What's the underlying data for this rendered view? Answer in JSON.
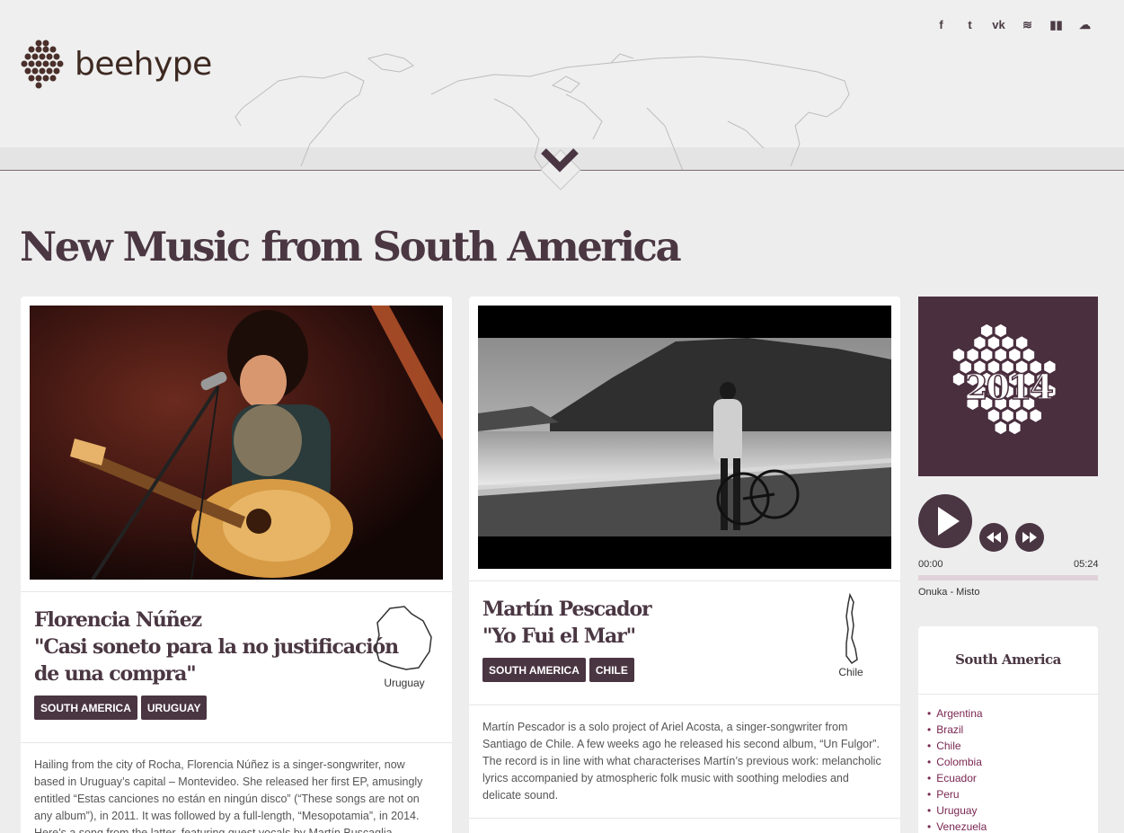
{
  "brand": {
    "name": "beehype"
  },
  "social": [
    {
      "icon": "facebook-icon",
      "glyph": "f"
    },
    {
      "icon": "twitter-icon",
      "glyph": "t"
    },
    {
      "icon": "vk-icon",
      "glyph": "vk"
    },
    {
      "icon": "spotify-icon",
      "glyph": "≋"
    },
    {
      "icon": "deezer-icon",
      "glyph": "▮▮"
    },
    {
      "icon": "soundcloud-icon",
      "glyph": "☁"
    }
  ],
  "page": {
    "title": "New Music from South America"
  },
  "posts": [
    {
      "title_line1": "Florencia Núñez",
      "title_line2": "\"Casi soneto para la no justificación",
      "title_line3": "de una compra\"",
      "tags": [
        "SOUTH AMERICA",
        "URUGUAY"
      ],
      "country": "Uruguay",
      "text": "Hailing from the city of Rocha, Florencia Núñez is a singer-songwriter, now based in Uruguay’s capital – Montevideo. She released her first EP, amusingly entitled “Estas canciones no están en ningún disco” (“These songs are not on any album”), in 2011. It was followed by a full-length, “Mesopotamia”, in 2014. Here’s a song from the latter, featuring guest vocals by Martín Buscaglia."
    },
    {
      "title_line1": "Martín Pescador",
      "title_line2": "\"Yo Fui el Mar\"",
      "tags": [
        "SOUTH AMERICA",
        "CHILE"
      ],
      "country": "Chile",
      "text": "Martín Pescador is a solo project of Ariel Acosta, a singer-songwriter from Santiago de Chile. A few weeks ago he released his second album, “Un Fulgor”. The record is in line with what characterises Martín’s previous work: melancholic lyrics accompanied by atmospheric folk music with soothing melodies and delicate sound."
    }
  ],
  "player": {
    "cover_text": "2014",
    "current_time": "00:00",
    "duration": "05:24",
    "progress": 0,
    "track": "Onuka - Misto"
  },
  "region": {
    "title": "South America",
    "countries": [
      "Argentina",
      "Brazil",
      "Chile",
      "Colombia",
      "Ecuador",
      "Peru",
      "Uruguay",
      "Venezuela"
    ]
  }
}
